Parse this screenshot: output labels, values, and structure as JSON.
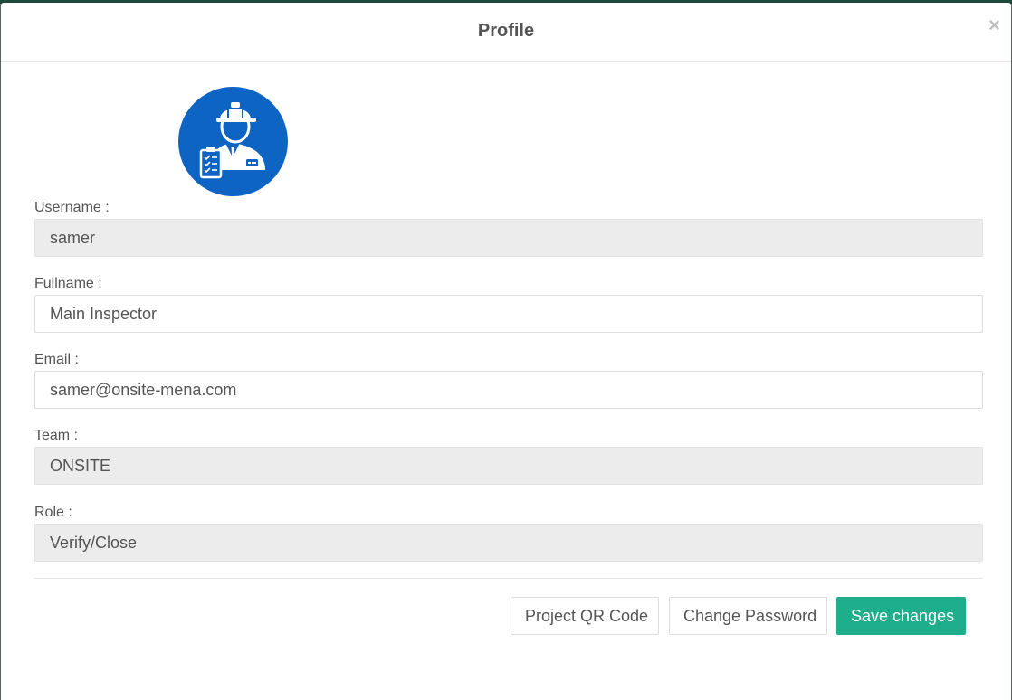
{
  "modal": {
    "title": "Profile",
    "close_label": "×"
  },
  "avatar": {
    "icon": "inspector-avatar-icon",
    "color": "#0e64c2"
  },
  "fields": {
    "username": {
      "label": "Username :",
      "value": "samer",
      "readonly": true
    },
    "fullname": {
      "label": "Fullname :",
      "value": "Main Inspector",
      "readonly": false
    },
    "email": {
      "label": "Email :",
      "value": "samer@onsite-mena.com",
      "readonly": false
    },
    "team": {
      "label": "Team :",
      "value": "ONSITE",
      "readonly": true
    },
    "role": {
      "label": "Role :",
      "value": "Verify/Close",
      "readonly": true
    }
  },
  "buttons": {
    "qr_label": "Project QR Code",
    "password_label": "Change Password",
    "save_label": "Save changes"
  },
  "colors": {
    "primary": "#1fae8c",
    "readonly_bg": "#ececec"
  }
}
